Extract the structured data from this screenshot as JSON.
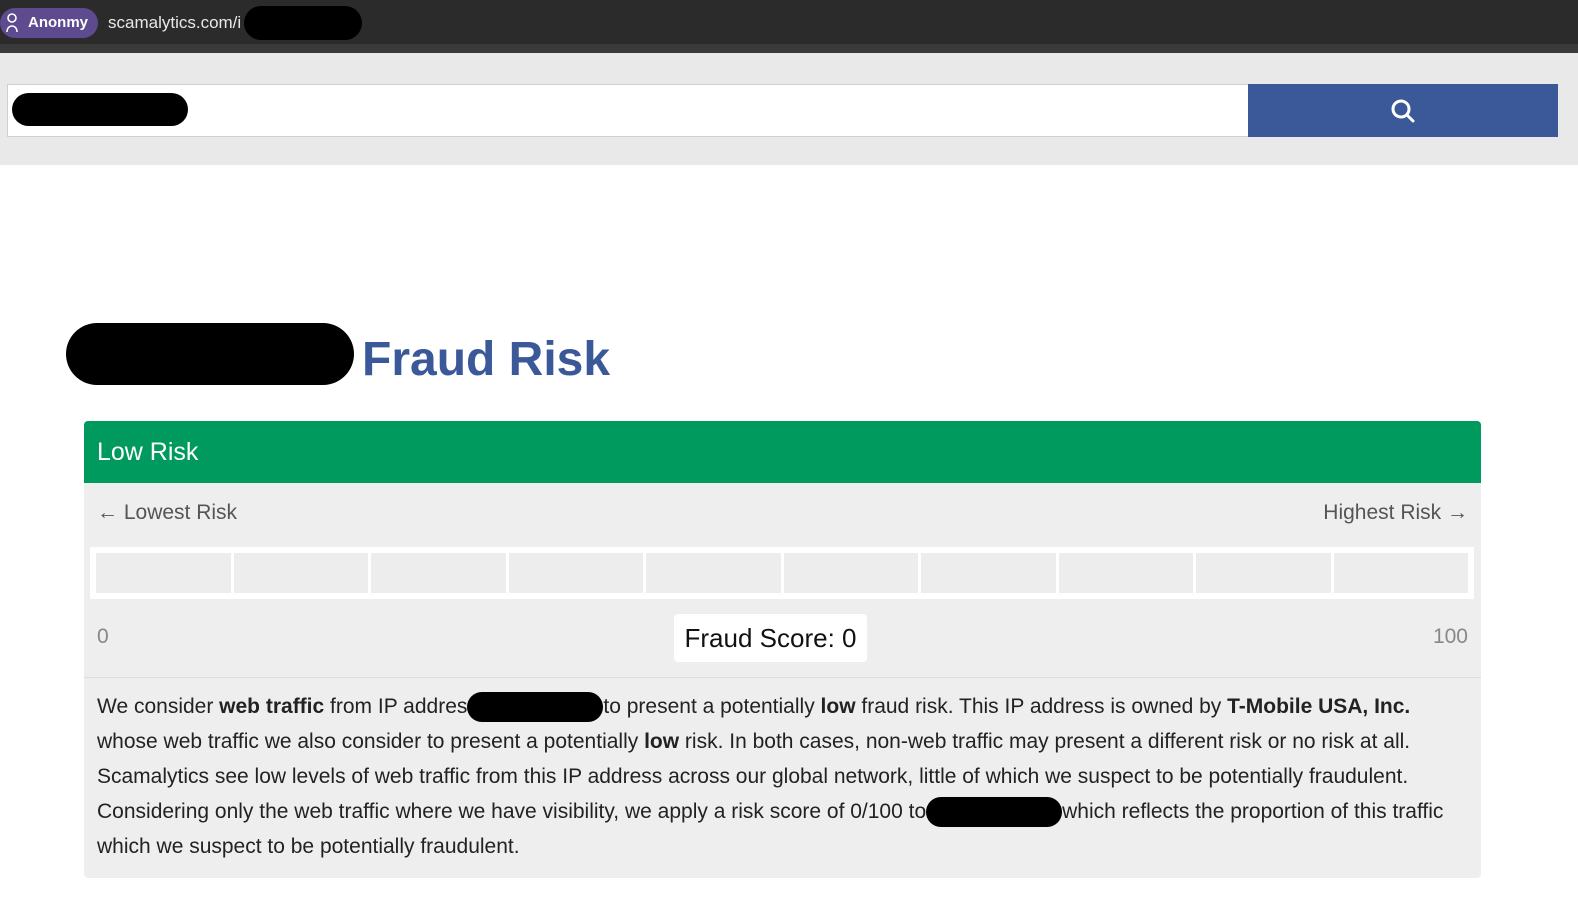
{
  "browser": {
    "mode_label": "Anonmy",
    "url": "scamalytics.com/i"
  },
  "search": {
    "button_icon": "search-icon",
    "accent_color": "#3b5998"
  },
  "heading": {
    "title": "Fraud Risk"
  },
  "risk_panel": {
    "header_label": "Low Risk",
    "header_color": "#009a5e",
    "lowest_label": "← Lowest Risk",
    "highest_label": "Highest Risk →",
    "meter_segments": 10,
    "score_min": "0",
    "score_max": "100",
    "fraud_score_label": "Fraud Score: 0",
    "fraud_score_value": 0
  },
  "description": {
    "p1_a": "We consider ",
    "p1_b": "web traffic",
    "p1_c": " from IP addres",
    "p1_d": "to present a potentially ",
    "p1_e": "low",
    "p1_f": " fraud risk. This IP address is owned by ",
    "p1_g": "T-Mobile USA, Inc.",
    "p1_h": " whose web traffic we also consider to present a potentially ",
    "p1_i": "low",
    "p1_j": " risk. In both cases, non-web traffic may present a different risk or no risk at all. Scamalytics see low levels of web traffic from this IP address across our global network, little of which we suspect to be potentially fraudulent. Considering only the web traffic where we have visibility, we apply a risk score of 0/100 to",
    "p1_k": "which reflects the proportion of this traffic which we suspect to be potentially fraudulent."
  }
}
